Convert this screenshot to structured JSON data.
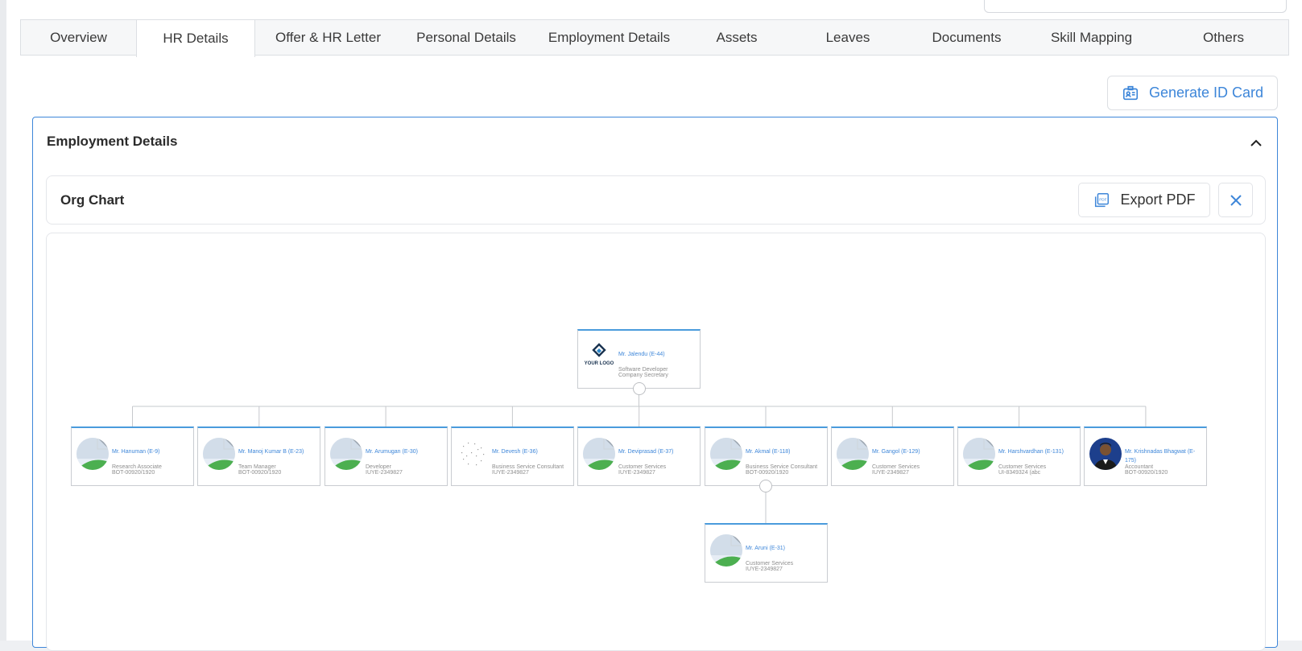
{
  "tabs": [
    {
      "label": "Overview"
    },
    {
      "label": "HR Details",
      "active": true
    },
    {
      "label": "Offer & HR Letter"
    },
    {
      "label": "Personal Details"
    },
    {
      "label": "Employment Details"
    },
    {
      "label": "Assets"
    },
    {
      "label": "Leaves"
    },
    {
      "label": "Documents"
    },
    {
      "label": "Skill Mapping"
    },
    {
      "label": "Others"
    }
  ],
  "actions": {
    "generate_id_card": "Generate ID Card"
  },
  "section": {
    "title": "Employment Details"
  },
  "org_chart": {
    "title": "Org Chart",
    "export_label": "Export PDF",
    "root": {
      "name": "Mr. Jalendu (E-44)",
      "role": "Software Developer",
      "code": "Company Secretary",
      "avatar": "logo"
    },
    "children": [
      {
        "name": "Mr. Hanuman (E-9)",
        "role": "Research Associate",
        "code": "BOT-00920/1920",
        "avatar": "placeholder"
      },
      {
        "name": "Mr. Manoj Kumar B (E-23)",
        "role": "Team Manager",
        "code": "BOT-00920/1920",
        "avatar": "placeholder"
      },
      {
        "name": "Mr. Arumugan (E-30)",
        "role": "Developer",
        "code": "IUYE-2349827",
        "avatar": "placeholder"
      },
      {
        "name": "Mr. Devesh (E-36)",
        "role": "Business Service Consultant",
        "code": "IUYE-2349827",
        "avatar": "dotted"
      },
      {
        "name": "Mr. Deviprasad (E-37)",
        "role": "Customer Services",
        "code": "IUYE-2349827",
        "avatar": "placeholder"
      },
      {
        "name": "Mr. Akmal (E-118)",
        "role": "Business Service Consultant",
        "code": "BOT-00920/1920",
        "avatar": "placeholder"
      },
      {
        "name": "Mr. Gangol (E-129)",
        "role": "Customer Services",
        "code": "IUYE-2349827",
        "avatar": "placeholder"
      },
      {
        "name": "Mr. Harshvardhan (E-131)",
        "role": "Customer Services",
        "code": "UI-8349324 (abc",
        "avatar": "placeholder"
      },
      {
        "name": "Mr. Krishnadas Bhagwat (E-175)",
        "role": "Accountant",
        "code": "BOT-00920/1920",
        "avatar": "photo"
      }
    ],
    "grandchild": {
      "name": "Mr. Aruni (E-31)",
      "role": "Customer Services",
      "code": "IUYE-2349827",
      "avatar": "placeholder",
      "parent_index": 5
    }
  },
  "colors": {
    "accent": "#3d86d9",
    "border": "#dcdfe3",
    "node_top": "#4a9bdc"
  },
  "icons": {
    "generate": "id-card-icon",
    "export": "pdf-icon",
    "close": "close-icon",
    "collapse": "chevron-up-icon"
  }
}
